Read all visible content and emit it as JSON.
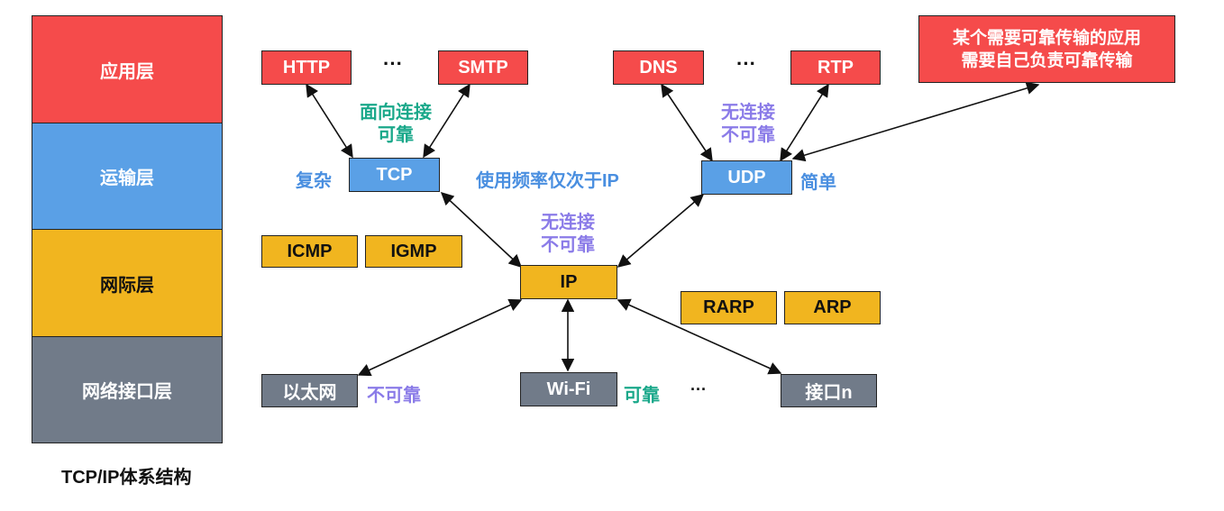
{
  "caption": "TCP/IP体系结构",
  "layers": {
    "application": {
      "label": "应用层",
      "color": "#f54b4b"
    },
    "transport": {
      "label": "运输层",
      "color": "#5aa0e6"
    },
    "internet": {
      "label": "网际层",
      "color": "#f1b51f"
    },
    "link": {
      "label": "网络接口层",
      "color": "#717b89"
    }
  },
  "protocols": {
    "http": "HTTP",
    "smtp": "SMTP",
    "dns": "DNS",
    "rtp": "RTP",
    "tcp": "TCP",
    "udp": "UDP",
    "icmp": "ICMP",
    "igmp": "IGMP",
    "ip": "IP",
    "rarp": "RARP",
    "arp": "ARP",
    "ethernet": "以太网",
    "wifi": "Wi-Fi",
    "iface_n": "接口n"
  },
  "ellipsis": "···",
  "annotations": {
    "tcp_conn_1": "面向连接",
    "tcp_conn_2": "可靠",
    "tcp_complex": "复杂",
    "tcp_freq": "使用频率仅次于IP",
    "udp_conn_1": "无连接",
    "udp_conn_2": "不可靠",
    "udp_simple": "简单",
    "ip_conn_1": "无连接",
    "ip_conn_2": "不可靠",
    "eth_unreliable": "不可靠",
    "wifi_reliable": "可靠"
  },
  "note": {
    "line1": "某个需要可靠传输的应用",
    "line2": "需要自己负责可靠传输"
  },
  "colors": {
    "green_text": "#1aa88a",
    "purple_text": "#8a7be8",
    "blue_text": "#4a8fe0"
  }
}
